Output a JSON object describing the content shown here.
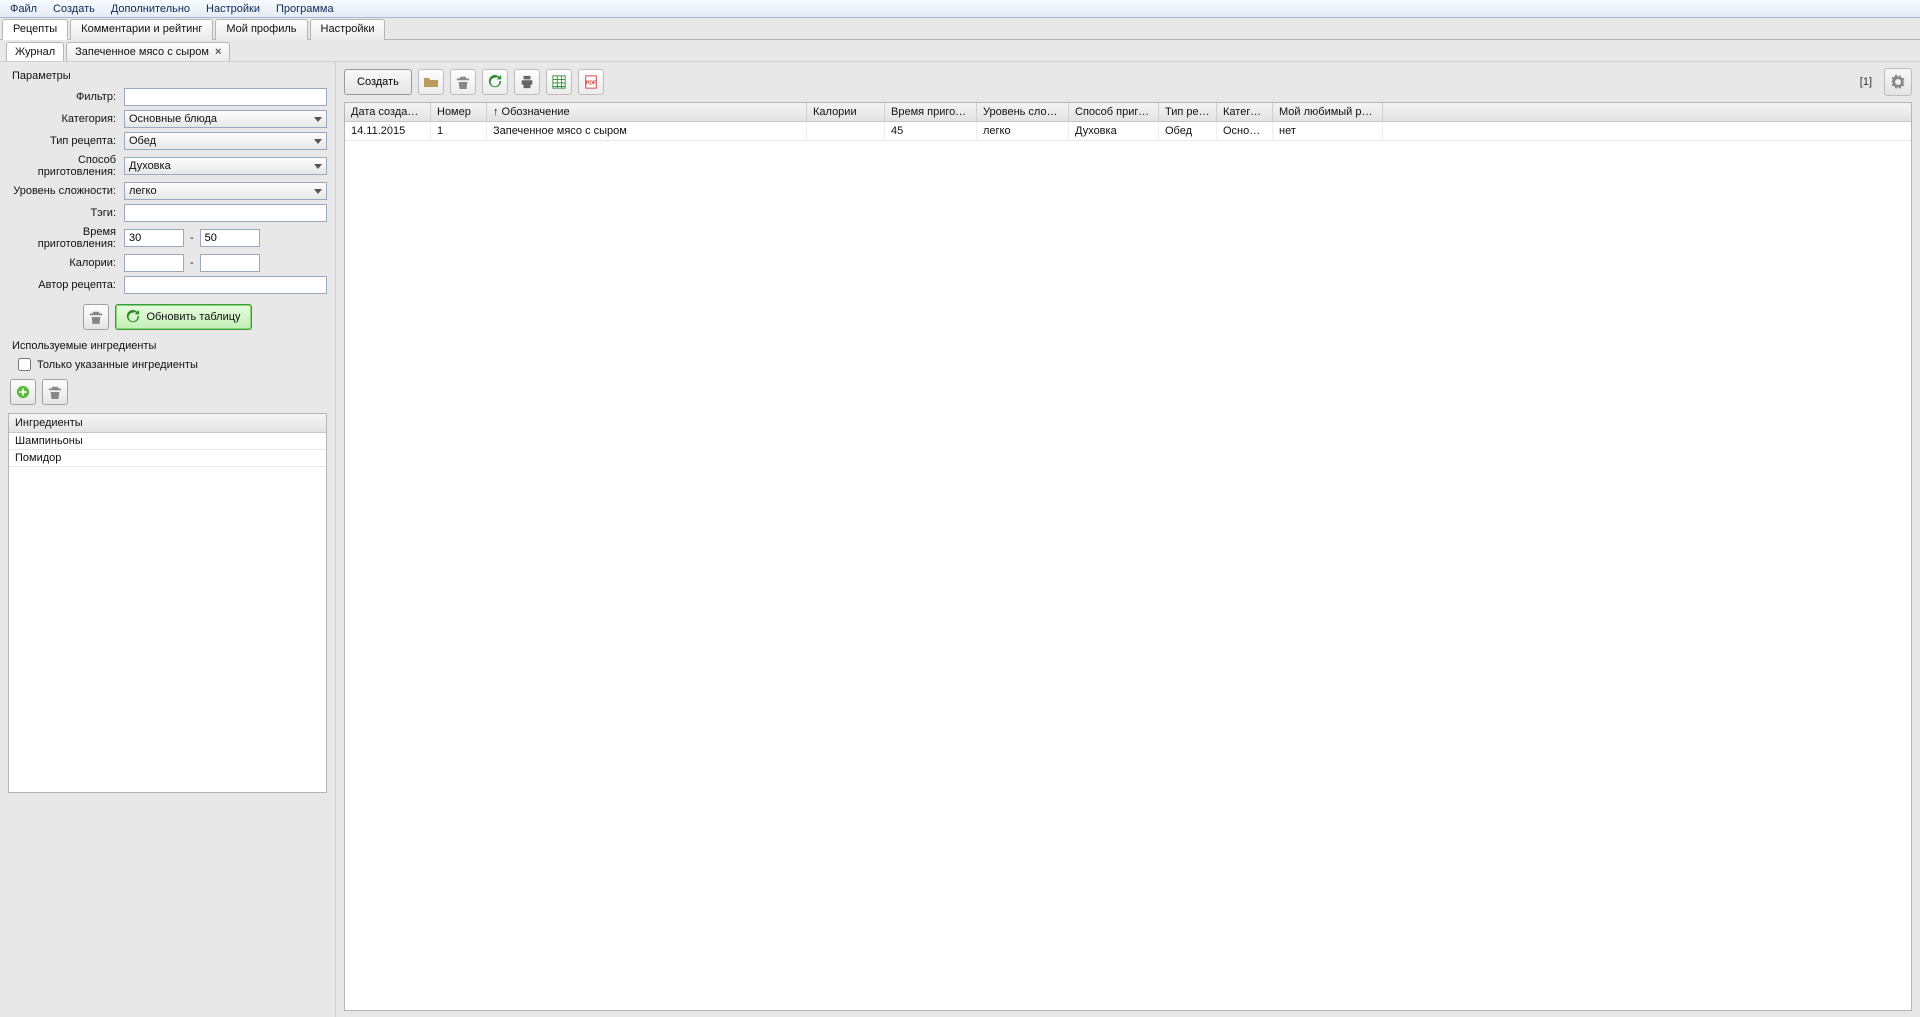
{
  "menu": {
    "file": "Файл",
    "create": "Создать",
    "extra": "Дополнительно",
    "settings": "Настройки",
    "program": "Программа"
  },
  "tabs": {
    "recipes": "Рецепты",
    "comments": "Комментарии и рейтинг",
    "profile": "Мой профиль",
    "settings": "Настройки"
  },
  "subtabs": {
    "journal": "Журнал",
    "recipe_open": "Запеченное мясо с сыром"
  },
  "params": {
    "title": "Параметры",
    "filter_label": "Фильтр:",
    "filter_value": "",
    "category_label": "Категория:",
    "category_value": "Основные блюда",
    "type_label": "Тип рецепта:",
    "type_value": "Обед",
    "method_label": "Способ приготовления:",
    "method_value": "Духовка",
    "difficulty_label": "Уровень сложности:",
    "difficulty_value": "легко",
    "tags_label": "Тэги:",
    "tags_value": "",
    "time_label": "Время приготовления:",
    "time_from": "30",
    "time_to": "50",
    "calories_label": "Калории:",
    "calories_from": "",
    "calories_to": "",
    "author_label": "Автор рецепта:",
    "author_value": "",
    "refresh_btn": "Обновить таблицу"
  },
  "ingredients": {
    "section_title": "Используемые ингредиенты",
    "only_checkbox": "Только указанные ингредиенты",
    "header": "Ингредиенты",
    "rows": [
      "Шампиньоны",
      "Помидор"
    ]
  },
  "toolbar": {
    "create": "Создать",
    "count": "[1]"
  },
  "grid": {
    "headers": {
      "date": "Дата создания",
      "number": "Номер",
      "name": "↑ Обозначение",
      "calories": "Калории",
      "time": "Время приготовле...",
      "difficulty": "Уровень сложности",
      "method": "Способ приготовл...",
      "type": "Тип рецепта",
      "category": "Категория",
      "favorite": "Мой любимый рецепт"
    },
    "rows": [
      {
        "date": "14.11.2015",
        "number": "1",
        "name": "Запеченное мясо с сыром",
        "calories": "",
        "time": "45",
        "difficulty": "легко",
        "method": "Духовка",
        "type": "Обед",
        "category": "Основны...",
        "favorite": "нет"
      }
    ]
  }
}
